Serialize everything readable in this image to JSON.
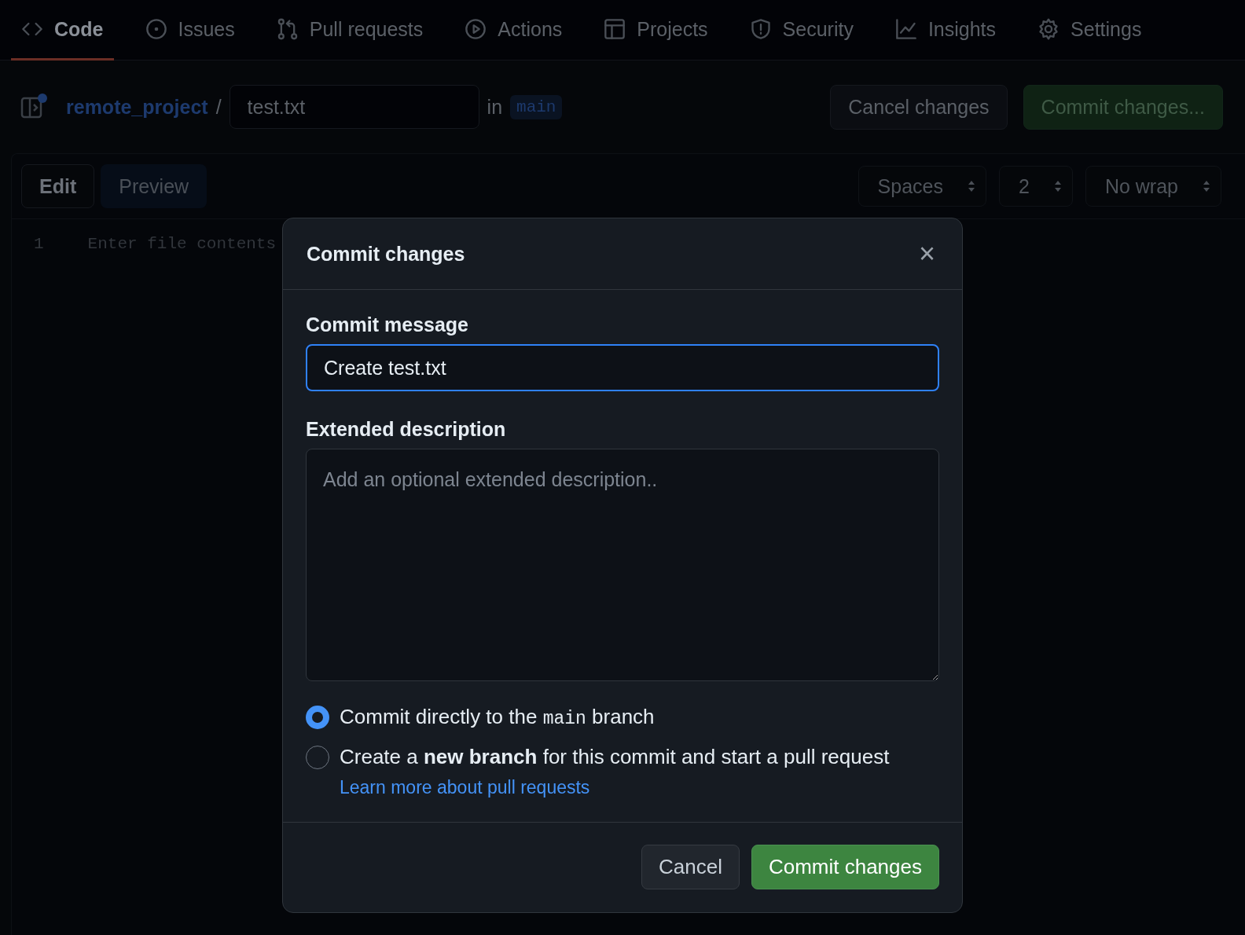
{
  "nav_tabs": [
    {
      "label": "Code",
      "selected": true
    },
    {
      "label": "Issues",
      "selected": false
    },
    {
      "label": "Pull requests",
      "selected": false
    },
    {
      "label": "Actions",
      "selected": false
    },
    {
      "label": "Projects",
      "selected": false
    },
    {
      "label": "Security",
      "selected": false
    },
    {
      "label": "Insights",
      "selected": false
    },
    {
      "label": "Settings",
      "selected": false
    }
  ],
  "breadcrumb": {
    "repository": "remote_project",
    "separator": "/",
    "filename": "test.txt",
    "in_label": "in",
    "branch": "main"
  },
  "header_buttons": [
    {
      "label": "Cancel changes",
      "kind": "secondary"
    },
    {
      "label": "Commit changes...",
      "kind": "primary"
    }
  ],
  "editor": {
    "tabs": [
      {
        "label": "Edit",
        "selected": true
      },
      {
        "label": "Preview",
        "selected": false
      }
    ],
    "selects": [
      {
        "value": "Spaces"
      },
      {
        "value": "2"
      },
      {
        "value": "No wrap"
      }
    ],
    "line_number": "1",
    "placeholder": "Enter file contents"
  },
  "dialog": {
    "title": "Commit changes",
    "close": "×",
    "message_label": "Commit message",
    "message_value": "Create test.txt",
    "description_label": "Extended description",
    "description_placeholder": "Add an optional extended description..",
    "options": [
      {
        "kind": "direct",
        "text_before": "Commit directly to the",
        "branch": "main",
        "text_after": "branch",
        "selected": true
      },
      {
        "kind": "new_branch",
        "text": "Create a **new branch** for this commit and start a pull request",
        "link": "Learn more about pull requests",
        "selected": false
      }
    ],
    "buttons": [
      {
        "label": "Cancel",
        "kind": "secondary"
      },
      {
        "label": "Commit changes",
        "kind": "primary"
      }
    ]
  }
}
